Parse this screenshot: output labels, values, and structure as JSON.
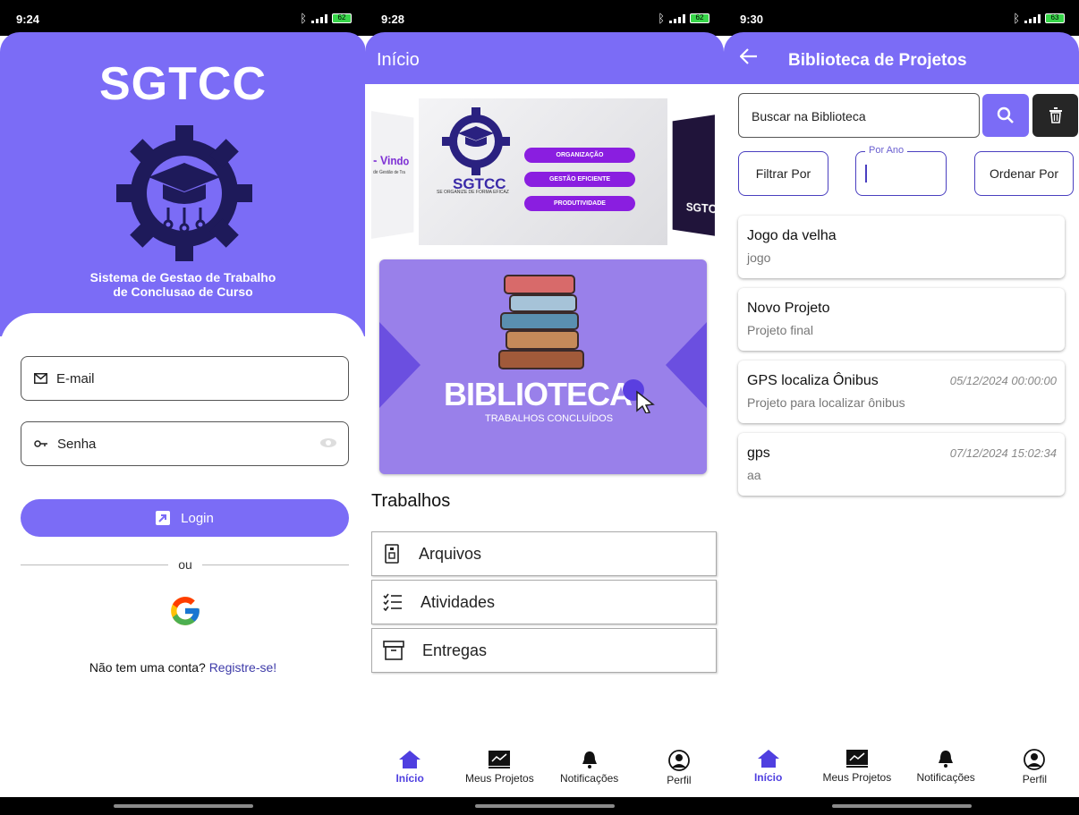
{
  "screen1": {
    "status_time": "9:24",
    "battery": "62",
    "logo_text": "SGTCC",
    "tagline_line1": "Sistema de Gestao de Trabalho",
    "tagline_line2": "de Conclusao de Curso",
    "email_label": "E-mail",
    "password_label": "Senha",
    "login_button": "Login",
    "or_label": "ou",
    "register_prompt": "Não tem uma conta?",
    "register_link": "Registre-se!"
  },
  "screen2": {
    "status_time": "9:28",
    "battery": "62",
    "title": "Início",
    "carousel": {
      "left_text": "- Vindo",
      "left_sub": "de Gestão de Tra",
      "brand": "SGTCC",
      "brand_sub": "SE ORGANIZE DE FORMA EFICAZ",
      "tags": [
        "ORGANIZAÇÃO",
        "GESTÃO EFICIENTE",
        "PRODUTIVIDADE"
      ],
      "right_text": "SGTC"
    },
    "biblioteca_title": "BIBLIOTECA",
    "biblioteca_sub": "TRABALHOS CONCLUÍDOS",
    "section_title": "Trabalhos",
    "menu": [
      {
        "label": "Arquivos",
        "icon": "archive-zip-icon"
      },
      {
        "label": "Atividades",
        "icon": "checklist-icon"
      },
      {
        "label": "Entregas",
        "icon": "box-icon"
      }
    ]
  },
  "screen3": {
    "status_time": "9:30",
    "battery": "63",
    "title": "Biblioteca de Projetos",
    "search_placeholder": "Buscar na Biblioteca",
    "filter_label": "Filtrar Por",
    "year_label": "Por Ano",
    "order_label": "Ordenar Por",
    "projects": [
      {
        "name": "Jogo da velha",
        "desc": "jogo",
        "date": ""
      },
      {
        "name": "Novo Projeto",
        "desc": "Projeto final",
        "date": ""
      },
      {
        "name": "GPS localiza Ônibus",
        "desc": "Projeto para localizar ônibus",
        "date": "05/12/2024 00:00:00"
      },
      {
        "name": "gps",
        "desc": "aa",
        "date": "07/12/2024 15:02:34"
      }
    ]
  },
  "bottom_nav": [
    "Início",
    "Meus Projetos",
    "Notificações",
    "Perfil"
  ],
  "colors": {
    "primary": "#7b6cf6",
    "accent": "#4f3fe0",
    "dark_button": "#262626",
    "tag_purple": "#8a1ee0"
  }
}
